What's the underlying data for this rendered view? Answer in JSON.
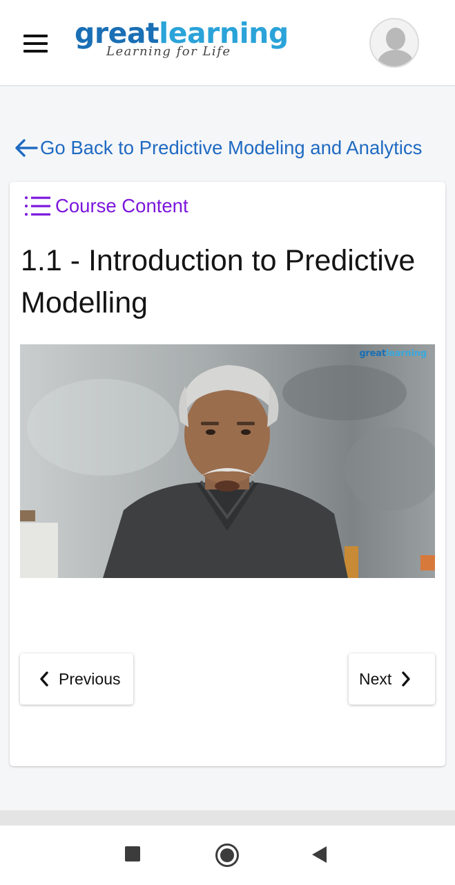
{
  "header": {
    "logo_great": "great",
    "logo_learning": "learning",
    "logo_tagline": "Learning for Life"
  },
  "back_link": {
    "label": "Go Back to Predictive Modeling and Analytics"
  },
  "course_content": {
    "label": "Course Content"
  },
  "lesson": {
    "title": "1.1 - Introduction to Predictive Modelling"
  },
  "video": {
    "watermark_great": "great",
    "watermark_learning": "learning"
  },
  "navigation": {
    "previous_label": "Previous",
    "next_label": "Next"
  },
  "colors": {
    "link_blue": "#1f6ac2",
    "course_content_purple": "#7b16dd",
    "logo_dark_blue": "#1a6fb5",
    "logo_light_blue": "#2aa3d9"
  },
  "icons": {
    "menu": "hamburger-menu-icon",
    "back": "arrow-left-icon",
    "course_content": "list-icon",
    "previous": "chevron-left-icon",
    "next": "chevron-right-icon",
    "avatar": "user-avatar-icon"
  }
}
